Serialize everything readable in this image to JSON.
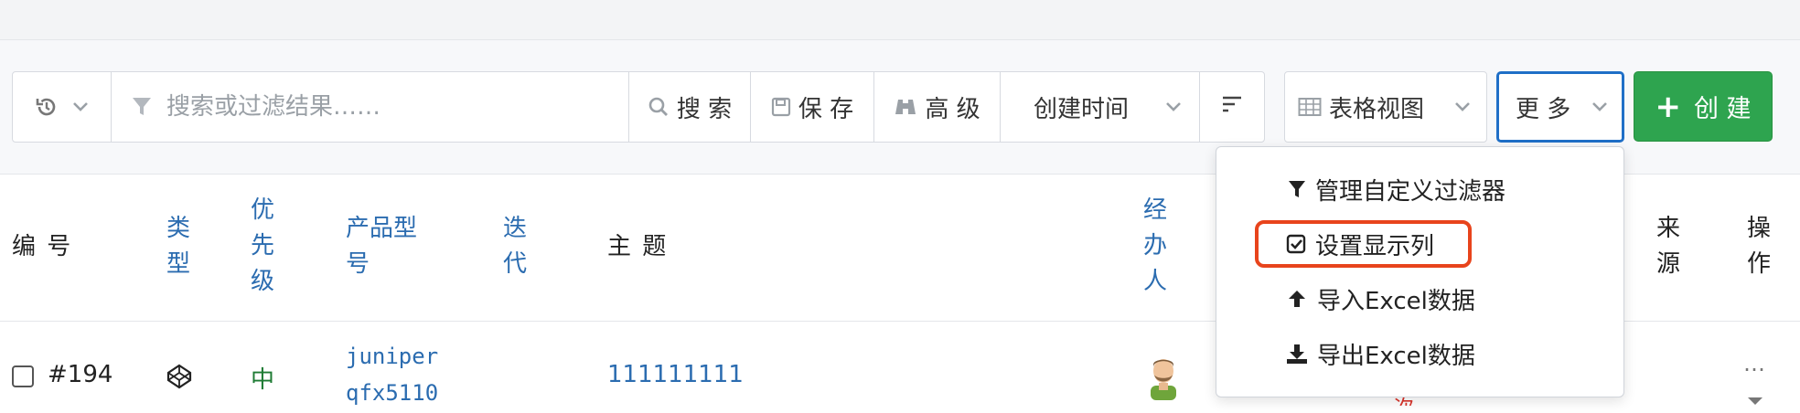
{
  "toolbar": {
    "search_placeholder": "搜索或过滤结果……",
    "search_label": "搜 索",
    "save_label": "保 存",
    "advanced_label": "高 级",
    "sort_value": "创建时间",
    "view_value": "表格视图",
    "more_label": "更 多",
    "create_label": "创 建"
  },
  "columns": {
    "number": "编 号",
    "type": "类型",
    "priority": "优先级",
    "product_model": "产品型号",
    "iteration": "迭代",
    "subject": "主 题",
    "assignee": "经办人",
    "source": "来源",
    "actions": "操作"
  },
  "row": {
    "number": "#194",
    "priority": "中",
    "product_line1": "juniper",
    "product_line2": "qfx5110",
    "subject": "111111111",
    "actions": "…"
  },
  "more_menu": {
    "items": [
      {
        "label": "管理自定义过滤器",
        "icon": "filter-icon"
      },
      {
        "label": "设置显示列",
        "icon": "checkbox-square-icon"
      },
      {
        "label": "导入Excel数据",
        "icon": "arrow-up-icon"
      },
      {
        "label": "导出Excel数据",
        "icon": "download-icon"
      }
    ]
  },
  "colors": {
    "link": "#2b6cb0",
    "priority_medium": "#1e7b34",
    "create_button": "#2ea44f",
    "focus_border": "#1f6fc7",
    "highlight_outline": "#e8441c"
  }
}
